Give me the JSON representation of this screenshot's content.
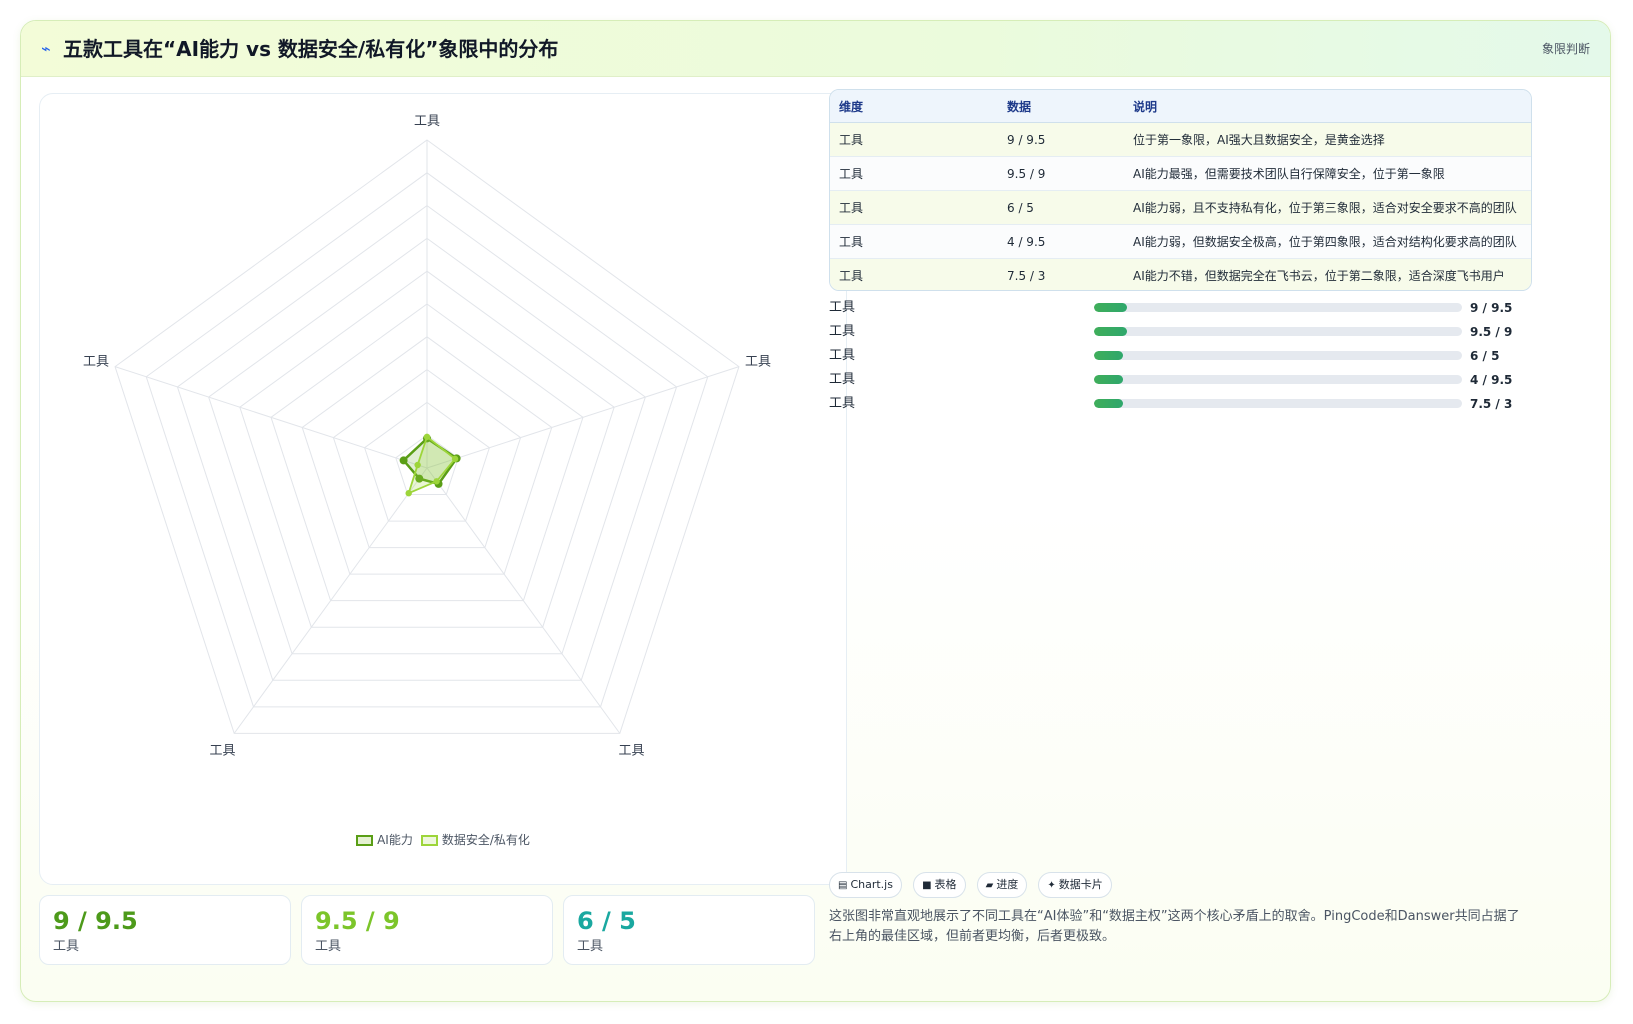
{
  "header": {
    "icon": "pulse-icon",
    "title": "五款工具在“AI能力 vs 数据安全/私有化”象限中的分布",
    "tag": "象限判断"
  },
  "chart_data": {
    "type": "radar",
    "axes": [
      "工具",
      "工具",
      "工具",
      "工具",
      "工具"
    ],
    "r_range": [
      0,
      100
    ],
    "rings": 10,
    "series": [
      {
        "name": "AI能力",
        "values": [
          9,
          9.5,
          6,
          4,
          7.5
        ],
        "color": "#5a9e16"
      },
      {
        "name": "数据安全/私有化",
        "values": [
          9.5,
          9,
          5,
          9.5,
          3
        ],
        "color": "#9dd53a"
      }
    ],
    "legend_position": "bottom"
  },
  "kpis": [
    {
      "value": "9 / 9.5",
      "label": "工具",
      "color": "#4d9a1a"
    },
    {
      "value": "9.5 / 9",
      "label": "工具",
      "color": "#7cc52a"
    },
    {
      "value": "6 / 5",
      "label": "工具",
      "color": "#1aa8a0"
    }
  ],
  "table": {
    "headers": [
      "维度",
      "数据",
      "说明"
    ],
    "rows": [
      [
        "工具",
        "9 / 9.5",
        "位于第一象限，AI强大且数据安全，是黄金选择"
      ],
      [
        "工具",
        "9.5 / 9",
        "AI能力最强，但需要技术团队自行保障安全，位于第一象限"
      ],
      [
        "工具",
        "6 / 5",
        "AI能力弱，且不支持私有化，位于第三象限，适合对安全要求不高的团队"
      ],
      [
        "工具",
        "4 / 9.5",
        "AI能力弱，但数据安全极高，位于第四象限，适合对结构化要求高的团队"
      ],
      [
        "工具",
        "7.5 / 3",
        "AI能力不错，但数据完全在飞书云，位于第二象限，适合深度飞书用户"
      ]
    ]
  },
  "bars": [
    {
      "label": "工具",
      "value": "9 / 9.5",
      "fraction": 0.09
    },
    {
      "label": "工具",
      "value": "9.5 / 9",
      "fraction": 0.09
    },
    {
      "label": "工具",
      "value": "6 / 5",
      "fraction": 0.08
    },
    {
      "label": "工具",
      "value": "4 / 9.5",
      "fraction": 0.08
    },
    {
      "label": "工具",
      "value": "7.5 / 3",
      "fraction": 0.08
    }
  ],
  "chips": [
    {
      "icon": "chart-icon",
      "glyph": "▤",
      "label": "Chart.js"
    },
    {
      "icon": "table-icon",
      "glyph": "■",
      "label": "表格"
    },
    {
      "icon": "progress-icon",
      "glyph": "▰",
      "label": "进度"
    },
    {
      "icon": "sparkle-icon",
      "glyph": "✦",
      "label": "数据卡片"
    }
  ],
  "description": "这张图非常直观地展示了不同工具在“AI体验”和“数据主权”这两个核心矛盾上的取舍。PingCode和Danswer共同占据了右上角的最佳区域，但前者更均衡，后者更极致。"
}
